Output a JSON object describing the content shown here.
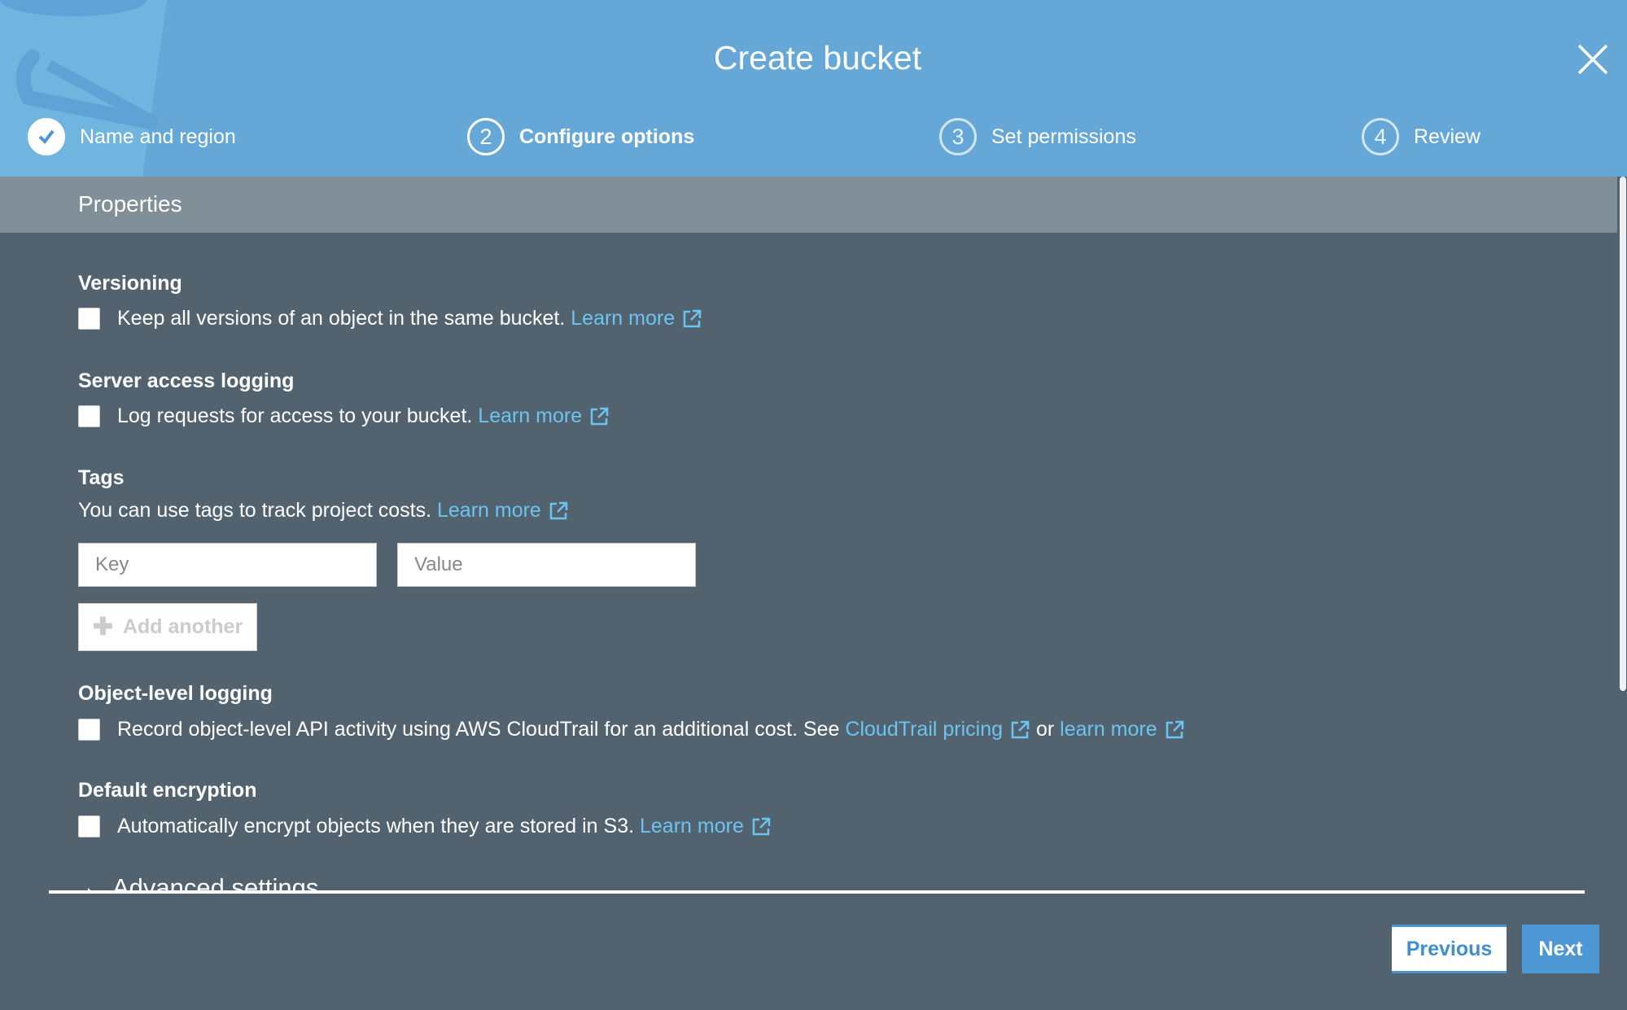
{
  "header": {
    "title": "Create bucket",
    "close_icon": "close-icon",
    "steps": [
      {
        "number": "",
        "label": "Name and region",
        "state": "completed",
        "icon": "check-circle-icon"
      },
      {
        "number": "2",
        "label": "Configure options",
        "state": "active"
      },
      {
        "number": "3",
        "label": "Set permissions",
        "state": "pending"
      },
      {
        "number": "4",
        "label": "Review",
        "state": "pending"
      }
    ]
  },
  "section": {
    "title": "Properties"
  },
  "versioning": {
    "title": "Versioning",
    "text": "Keep all versions of an object in the same bucket. ",
    "link": "Learn more",
    "checked": false
  },
  "logging": {
    "title": "Server access logging",
    "text": "Log requests for access to your bucket. ",
    "link": "Learn more",
    "checked": false
  },
  "tags": {
    "title": "Tags",
    "text": "You can use tags to track project costs. ",
    "link": "Learn more",
    "key_placeholder": "Key",
    "value_placeholder": "Value",
    "add_label": "Add another"
  },
  "object_logging": {
    "title": "Object-level logging",
    "text": "Record object-level API activity using AWS CloudTrail for an additional cost. See ",
    "link1": "CloudTrail pricing",
    "or": " or ",
    "link2": "learn more",
    "checked": false
  },
  "encryption": {
    "title": "Default encryption",
    "text": "Automatically encrypt objects when they are stored in S3. ",
    "link": "Learn more",
    "checked": false
  },
  "advanced": {
    "label": "Advanced settings"
  },
  "footer": {
    "previous": "Previous",
    "next": "Next"
  },
  "colors": {
    "header": "#65a7d7",
    "section_bar": "#818f98",
    "background": "#52636f",
    "link": "#6cc4f0",
    "primary": "#4d98d4"
  }
}
